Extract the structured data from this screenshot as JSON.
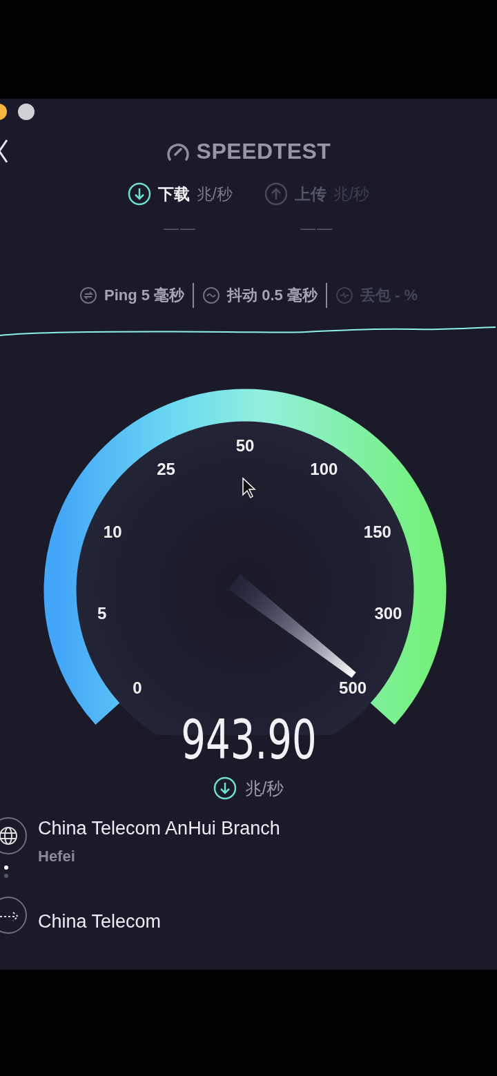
{
  "window": {
    "buttons": [
      {
        "color": "#f5b73d"
      },
      {
        "color": "#cfcfd4"
      }
    ]
  },
  "header": {
    "title": "SPEEDTEST"
  },
  "tabs": [
    {
      "label": "下载",
      "unit": "兆/秒",
      "value": "——",
      "selected": true
    },
    {
      "label": "上传",
      "unit": "兆/秒",
      "value": "——",
      "selected": false
    }
  ],
  "metrics": [
    {
      "kind": "ping",
      "text": "Ping 5 毫秒",
      "disabled": false
    },
    {
      "kind": "jitter",
      "text": "抖动 0.5 毫秒",
      "disabled": false
    },
    {
      "kind": "loss",
      "text": "丢包 - %",
      "disabled": true
    }
  ],
  "gauge": {
    "labels": [
      "0",
      "5",
      "10",
      "25",
      "50",
      "100",
      "150",
      "300",
      "500"
    ]
  },
  "speed": {
    "value": "943.90",
    "unit": "兆/秒"
  },
  "connections": [
    {
      "kind": "server",
      "name": "China Telecom AnHui Branch",
      "location": "Hefei"
    },
    {
      "kind": "provider",
      "name": "China Telecom"
    }
  ]
}
